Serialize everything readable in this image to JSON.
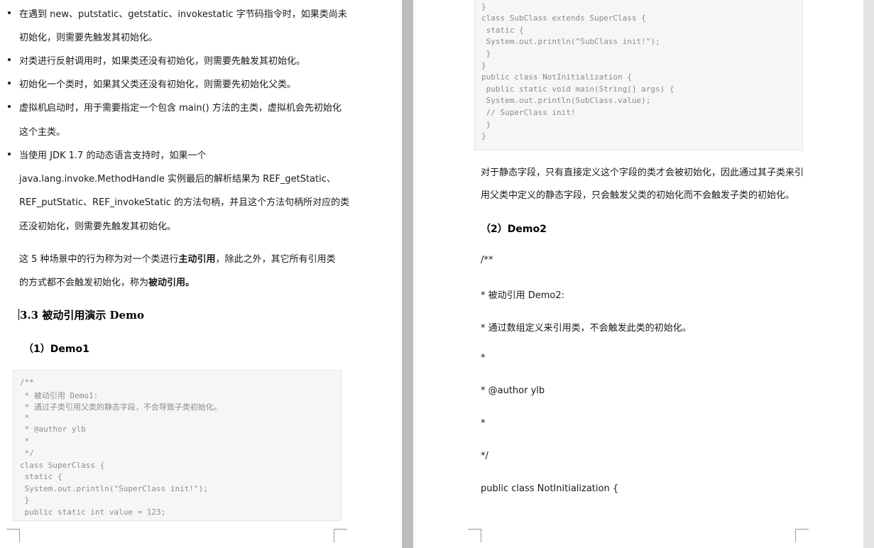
{
  "left_page": {
    "bullets": [
      {
        "lines": [
          "在遇到 new、putstatic、getstatic、invokestatic 字节码指令时，如果类尚未",
          "初始化，则需要先触发其初始化。"
        ]
      },
      {
        "lines": [
          "对类进行反射调用时，如果类还没有初始化，则需要先触发其初始化。"
        ]
      },
      {
        "lines": [
          "初始化一个类时，如果其父类还没有初始化，则需要先初始化父类。"
        ]
      },
      {
        "lines": [
          "虚拟机启动时，用于需要指定一个包含 main() 方法的主类，虚拟机会先初始化",
          "这个主类。"
        ]
      },
      {
        "lines": [
          "当使用 JDK 1.7 的动态语言支持时，如果一个",
          "java.lang.invoke.MethodHandle 实例最后的解析结果为 REF_getStatic、",
          "REF_putStatic、REF_invokeStatic 的方法句柄，并且这个方法句柄所对应的类",
          "还没初始化，则需要先触发其初始化。"
        ]
      }
    ],
    "summary": {
      "line1_part1": "这 5 种场景中的行为称为对一个类进行",
      "line1_bold": "主动引用",
      "line1_part2": "，除此之外，其它所有引用类",
      "line2_part1": "的方式都不会触发初始化，称为",
      "line2_bold": "被动引用。"
    },
    "section_heading": "3.3 被动引用演示 Demo",
    "demo1_heading": "（1）Demo1",
    "code": [
      "/**",
      " * 被动引用 Demo1:",
      " * 通过子类引用父类的静态字段，不会导致子类初始化。",
      " *",
      " * @author ylb",
      " *",
      " */",
      "class SuperClass {",
      " static {",
      " System.out.println(\"SuperClass init!\");",
      " }",
      " public static int value = 123;"
    ]
  },
  "right_page": {
    "code": [
      "}",
      "class SubClass extends SuperClass {",
      " static {",
      " System.out.println(\"SubClass init!\");",
      " }",
      "}",
      "public class NotInitialization {",
      " public static void main(String[] args) {",
      " System.out.println(SubClass.value);",
      " // SuperClass init!",
      " }",
      "}"
    ],
    "para_lines": [
      "对于静态字段，只有直接定义这个字段的类才会被初始化，因此通过其子类来引",
      "用父类中定义的静态字段，只会触发父类的初始化而不会触发子类的初始化。"
    ],
    "demo2_heading": "（2）Demo2",
    "comment_lines": [
      "/**",
      "* 被动引用 Demo2:",
      "* 通过数组定义来引用类，不会触发此类的初始化。",
      "*",
      "* @author ylb",
      "*",
      "*/",
      "public class NotInitialization {"
    ]
  }
}
